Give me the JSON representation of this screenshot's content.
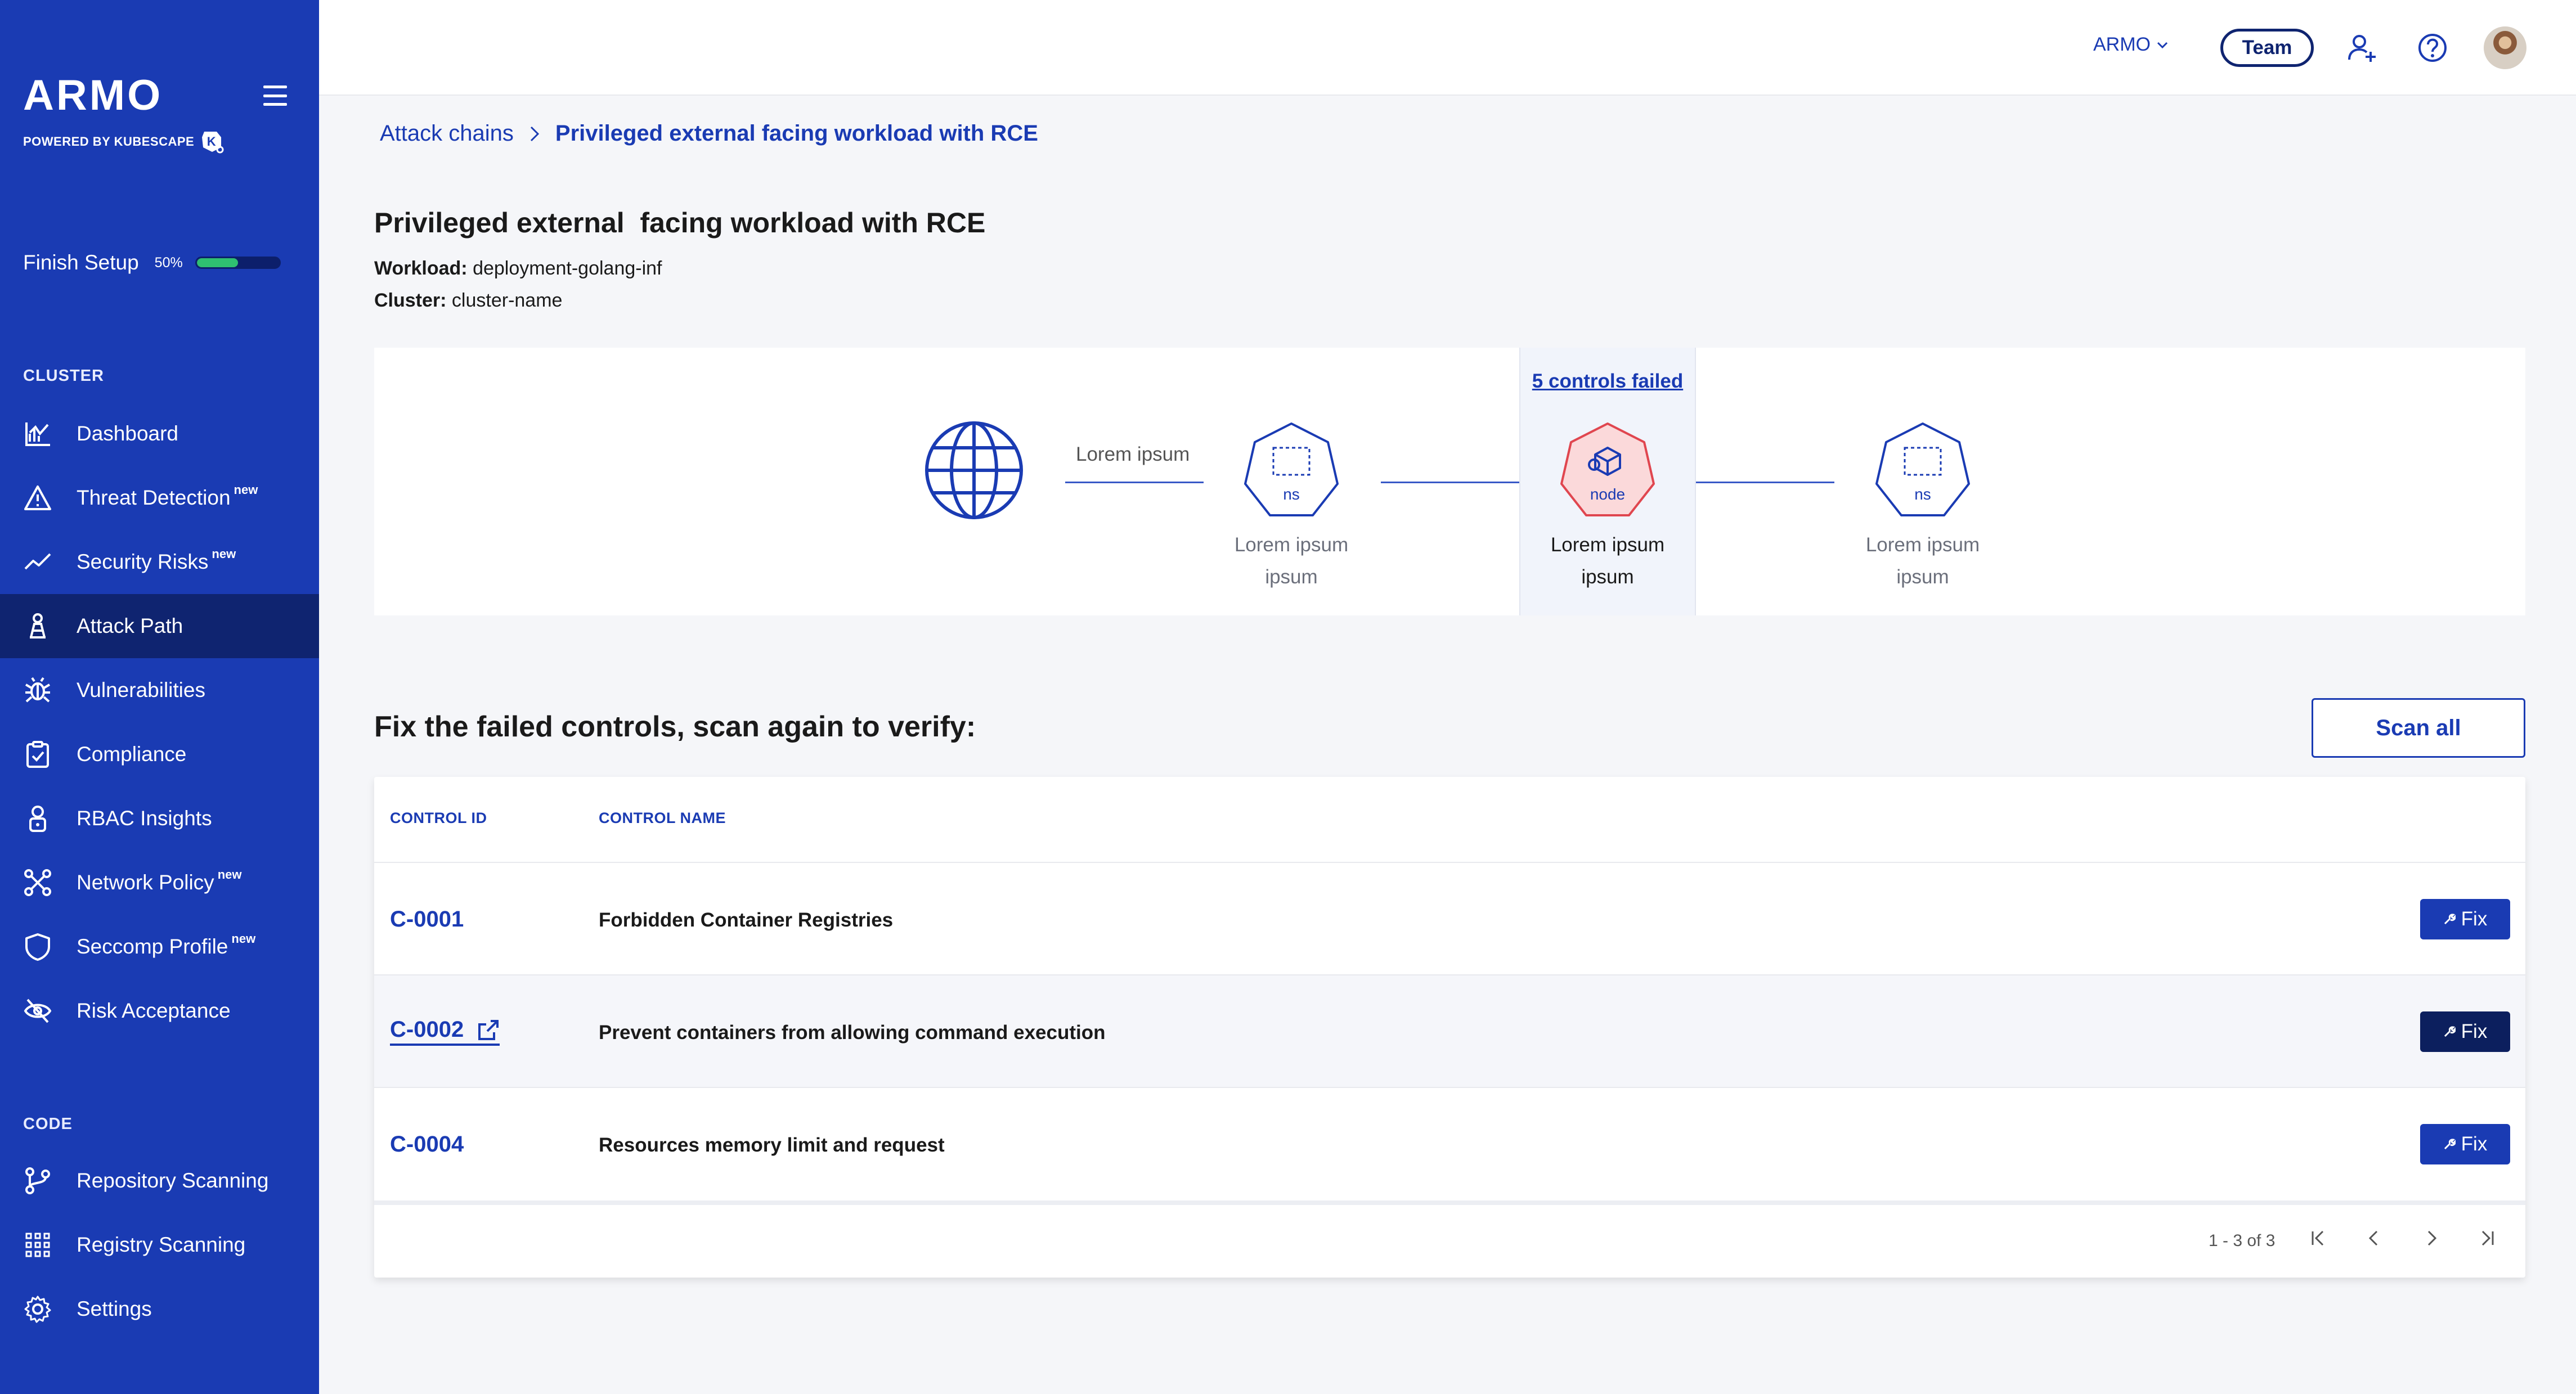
{
  "sidebar": {
    "logo": "ARMO",
    "powered_by": "POWERED BY KUBESCAPE",
    "finish_setup": {
      "label": "Finish Setup",
      "percent_text": "50%",
      "progress": 0.5
    },
    "cluster_label": "CLUSTER",
    "code_label": "CODE",
    "items": [
      {
        "label": "Dashboard",
        "icon": "dashboard-chart-icon",
        "badge": ""
      },
      {
        "label": "Threat Detection",
        "icon": "warning-triangle-icon",
        "badge": "new"
      },
      {
        "label": "Security Risks",
        "icon": "trend-line-icon",
        "badge": "new"
      },
      {
        "label": "Attack Path",
        "icon": "attack-path-icon",
        "badge": "",
        "active": true
      },
      {
        "label": "Vulnerabilities",
        "icon": "bug-icon",
        "badge": ""
      },
      {
        "label": "Compliance",
        "icon": "clipboard-check-icon",
        "badge": ""
      },
      {
        "label": "RBAC Insights",
        "icon": "user-lock-icon",
        "badge": ""
      },
      {
        "label": "Network Policy",
        "icon": "network-nodes-icon",
        "badge": "new"
      },
      {
        "label": "Seccomp Profile",
        "icon": "shield-icon",
        "badge": "new"
      },
      {
        "label": "Risk Acceptance",
        "icon": "eye-off-icon",
        "badge": ""
      },
      {
        "label": "Repository Scanning",
        "icon": "git-branch-icon",
        "badge": ""
      },
      {
        "label": "Registry Scanning",
        "icon": "grid-dots-icon",
        "badge": ""
      },
      {
        "label": "Settings",
        "icon": "gear-icon",
        "badge": ""
      }
    ]
  },
  "topbar": {
    "org": "ARMO",
    "team": "Team",
    "icons": [
      "add-user-icon",
      "help-circle-icon",
      "avatar"
    ]
  },
  "breadcrumb": {
    "parent": "Attack chains",
    "current": "Privileged external facing workload with RCE"
  },
  "page": {
    "title": "Privileged external  facing workload with RCE",
    "workload_label": "Workload:",
    "workload": "deployment-golang-inf",
    "cluster_label": "Cluster:",
    "cluster": "cluster-name"
  },
  "chain": {
    "edge_label": "Lorem ipsum",
    "failed_link": "5 controls failed",
    "nodes": [
      {
        "type": "globe"
      },
      {
        "type": "ns",
        "tag": "ns",
        "caption1": "Lorem ipsum",
        "caption2": "ipsum"
      },
      {
        "type": "node",
        "tag": "node",
        "caption1": "Lorem ipsum",
        "caption2": "ipsum",
        "failed": true
      },
      {
        "type": "ns",
        "tag": "ns",
        "caption1": "Lorem ipsum",
        "caption2": "ipsum"
      }
    ]
  },
  "fix_section": {
    "title": "Fix the failed controls, scan again to verify:",
    "scan_all": "Scan all",
    "columns": {
      "id": "CONTROL ID",
      "name": "CONTROL NAME"
    },
    "rows": [
      {
        "id": "C-0001",
        "name": "Forbidden Container Registries",
        "fix": "Fix"
      },
      {
        "id": "C-0002",
        "name": "Prevent containers from allowing command execution",
        "fix": "Fix"
      },
      {
        "id": "C-0004",
        "name": "Resources memory limit and request",
        "fix": "Fix"
      }
    ],
    "pagination": "1 - 3 of 3"
  },
  "colors": {
    "sidebar": "#1a3bb3",
    "sidebar_active": "#0f2470",
    "accent": "#1a3bb3",
    "failed_node": "#e0464f",
    "progress": "#2fbf71"
  }
}
